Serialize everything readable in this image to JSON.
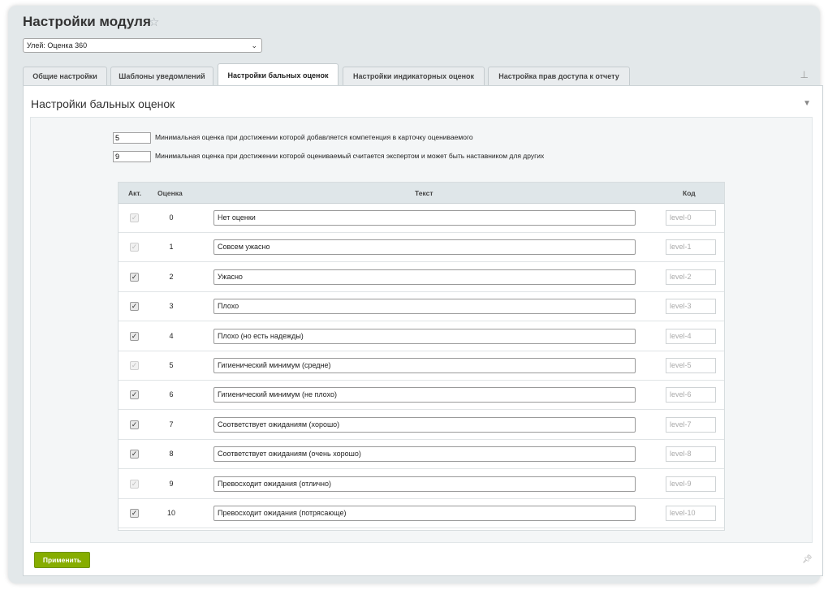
{
  "header": {
    "title": "Настройки модуля",
    "star_icon": "star-icon"
  },
  "selector": {
    "value": "Улей: Оценка 360"
  },
  "tabs": [
    {
      "label": "Общие настройки",
      "active": false
    },
    {
      "label": "Шаблоны уведомлений",
      "active": false
    },
    {
      "label": "Настройки бальных оценок",
      "active": true
    },
    {
      "label": "Настройки индикаторных оценок",
      "active": false
    },
    {
      "label": "Настройка прав доступа к отчету",
      "active": false
    }
  ],
  "section": {
    "title": "Настройки бальных оценок"
  },
  "settings": [
    {
      "value": "5",
      "label": "Минимальная оценка при достижении которой добавляется компетенция в карточку оцениваемого"
    },
    {
      "value": "9",
      "label": "Минимальная оценка при достижении которой оцениваемый считается экспертом и может быть наставником для других"
    }
  ],
  "table": {
    "headers": {
      "active": "Акт.",
      "score": "Оценка",
      "text": "Текст",
      "code": "Код"
    },
    "rows": [
      {
        "checked": true,
        "disabled": true,
        "score": "0",
        "text": "Нет оценки",
        "code": "level-0"
      },
      {
        "checked": true,
        "disabled": true,
        "score": "1",
        "text": "Совсем ужасно",
        "code": "level-1"
      },
      {
        "checked": true,
        "disabled": false,
        "score": "2",
        "text": "Ужасно",
        "code": "level-2"
      },
      {
        "checked": true,
        "disabled": false,
        "score": "3",
        "text": "Плохо",
        "code": "level-3"
      },
      {
        "checked": true,
        "disabled": false,
        "score": "4",
        "text": "Плохо (но есть надежды)",
        "code": "level-4"
      },
      {
        "checked": true,
        "disabled": true,
        "score": "5",
        "text": "Гигиенический минимум (средне)",
        "code": "level-5"
      },
      {
        "checked": true,
        "disabled": false,
        "score": "6",
        "text": "Гигиенический минимум (не плохо)",
        "code": "level-6"
      },
      {
        "checked": true,
        "disabled": false,
        "score": "7",
        "text": "Соответствует ожиданиям (хорошо)",
        "code": "level-7"
      },
      {
        "checked": true,
        "disabled": false,
        "score": "8",
        "text": "Соответствует ожиданиям (очень хорошо)",
        "code": "level-8"
      },
      {
        "checked": true,
        "disabled": true,
        "score": "9",
        "text": "Превосходит ожидания (отлично)",
        "code": "level-9"
      },
      {
        "checked": true,
        "disabled": false,
        "score": "10",
        "text": "Превосходит ожидания (потрясающе)",
        "code": "level-10"
      }
    ]
  },
  "footer": {
    "apply_label": "Применить"
  },
  "colors": {
    "accent": "#86ad00",
    "panel_bg": "#e3e8ea"
  }
}
